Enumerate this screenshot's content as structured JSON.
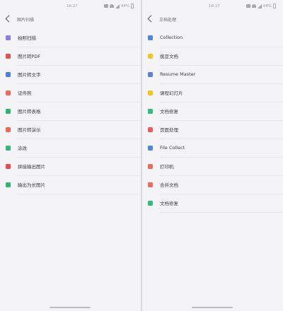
{
  "screens": [
    {
      "status": {
        "time": "16:27",
        "battery": "44%"
      },
      "title": "图片扫描",
      "items": [
        {
          "label": "拍照扫描",
          "icon": "scan-icon",
          "color": "#8e7be6"
        },
        {
          "label": "图片转PDF",
          "icon": "pdf-icon",
          "color": "#e6534a"
        },
        {
          "label": "图片转文字",
          "icon": "text-icon",
          "color": "#4a7de6"
        },
        {
          "label": "证件照",
          "icon": "id-photo-icon",
          "color": "#f06b5a"
        },
        {
          "label": "图片转表格",
          "icon": "table-icon",
          "color": "#2fb46b"
        },
        {
          "label": "图片转演示",
          "icon": "slides-icon",
          "color": "#f0694e"
        },
        {
          "label": "涂改",
          "icon": "erase-icon",
          "color": "#34b87a"
        },
        {
          "label": "拼接输出图片",
          "icon": "stitch-icon",
          "color": "#e64b4b"
        },
        {
          "label": "输出为长图片",
          "icon": "long-image-icon",
          "color": "#30b56c"
        }
      ]
    },
    {
      "status": {
        "time": "16:27",
        "battery": "44%"
      },
      "title": "文档处理",
      "items": [
        {
          "label": "Collection",
          "icon": "collection-icon",
          "color": "#4a86e8"
        },
        {
          "label": "挑豆文档",
          "icon": "note-icon",
          "color": "#f5c518"
        },
        {
          "label": "Resume Master",
          "icon": "resume-icon",
          "color": "#5b7fe0"
        },
        {
          "label": "课程幻灯片",
          "icon": "course-slides-icon",
          "color": "#f5c518"
        },
        {
          "label": "文档修复",
          "icon": "repair-icon",
          "color": "#2fbf7a"
        },
        {
          "label": "页面处理",
          "icon": "page-icon",
          "color": "#f05a5a"
        },
        {
          "label": "File Collect",
          "icon": "folder-icon",
          "color": "#4a86e8"
        },
        {
          "label": "打印机",
          "icon": "printer-icon",
          "color": "#f06c5a"
        },
        {
          "label": "合并文档",
          "icon": "merge-icon",
          "color": "#f06c5a"
        },
        {
          "label": "文档修复",
          "icon": "doc-repair-icon",
          "color": "#2fbf7a"
        }
      ]
    }
  ]
}
